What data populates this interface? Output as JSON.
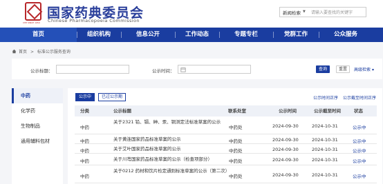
{
  "header": {
    "logo_caption": "CHP SINCE 1950",
    "title": "国家药典委员会",
    "subtitle": "Chinese Pharmacopoeia Commission",
    "search_scope": "新闻检索",
    "search_placeholder": "请输入要查找的关键字"
  },
  "nav": [
    {
      "label": "首页"
    },
    {
      "label": "组织机构"
    },
    {
      "label": "信息公开"
    },
    {
      "label": "工作动态"
    },
    {
      "label": "专题专栏"
    },
    {
      "label": "党群工作"
    },
    {
      "label": "公众服务"
    }
  ],
  "breadcrumb": {
    "home": "首页",
    "sep": ">",
    "current": "标准公示服务查询"
  },
  "filter": {
    "title_label": "公示标题：",
    "title_value": "",
    "time_label": "公示时间：",
    "time_value": "",
    "query_label": "查询",
    "reset_label": "重置",
    "advanced_label": "高级检索"
  },
  "sidebar": [
    {
      "label": "中药",
      "active": true
    },
    {
      "label": "化学药",
      "active": false
    },
    {
      "label": "生物制品",
      "active": false
    },
    {
      "label": "通用辅料包材",
      "active": false
    }
  ],
  "tabs": [
    {
      "label": "公示中",
      "active": true
    },
    {
      "label": "已过公示期",
      "active": false
    }
  ],
  "sort": {
    "by_time": "公示时间正序",
    "by_deadline": "公示截至时间正序"
  },
  "table": {
    "headers": [
      "分类",
      "公示标题",
      "联系处室",
      "公示时间",
      "公示截至时间",
      "状态"
    ],
    "rows": [
      {
        "category": "中药",
        "title": "关于2321 铅、镉、砷、汞、铜测定法标准草案的公示",
        "dept": "中药处",
        "date": "2024-09-30",
        "deadline": "2024-10-31",
        "status": "公示中"
      },
      {
        "category": "中药",
        "title": "关于黄连国家药品标准草案的公示",
        "dept": "中药处",
        "date": "2024-09-30",
        "deadline": "2024-10-31",
        "status": "公示中"
      },
      {
        "category": "中药",
        "title": "关于艾叶国家药品标准草案的公示",
        "dept": "中药处",
        "date": "2024-09-30",
        "deadline": "2024-10-31",
        "status": "公示中"
      },
      {
        "category": "中药",
        "title": "关于川芎国家药品标准草案的公示（检查项部分）",
        "dept": "中药处",
        "date": "2024-09-30",
        "deadline": "2024-10-31",
        "status": "公示中"
      },
      {
        "category": "中药",
        "title": "关于0212 药材和饮片检定通则标准草案的公示（第二次）",
        "dept": "中药处",
        "date": "2024-09-30",
        "deadline": "2024-10-31",
        "status": "公示中"
      }
    ]
  },
  "colors": {
    "primary": "#1a3da0",
    "brand_red": "#b8282b",
    "page_bg": "#f4f5f8"
  }
}
